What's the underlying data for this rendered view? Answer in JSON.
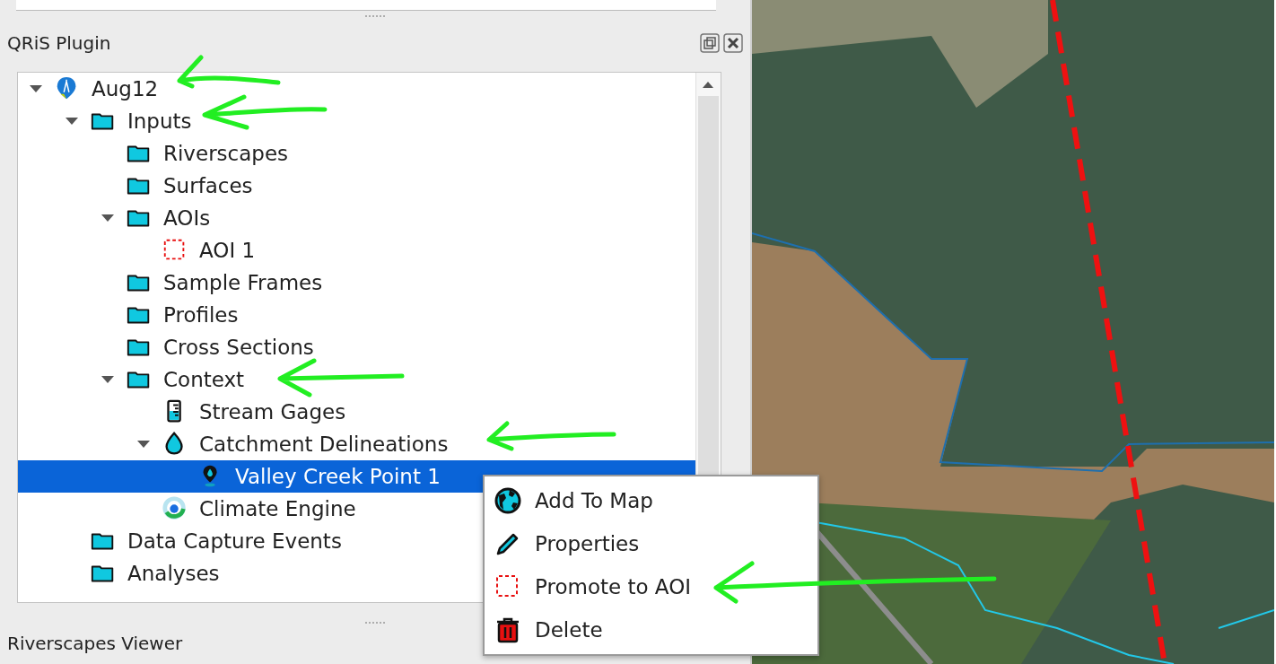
{
  "panel": {
    "title": "QRiS Plugin"
  },
  "tree": [
    {
      "label": "Aug12",
      "kind": "project",
      "expanded": true,
      "selected": false,
      "children": [
        {
          "label": "Inputs",
          "kind": "folder",
          "expanded": true,
          "selected": false,
          "children": [
            {
              "label": "Riverscapes",
              "kind": "folder",
              "selected": false
            },
            {
              "label": "Surfaces",
              "kind": "folder",
              "selected": false
            },
            {
              "label": "AOIs",
              "kind": "folder",
              "expanded": true,
              "selected": false,
              "children": [
                {
                  "label": "AOI 1",
                  "kind": "aoi",
                  "selected": false
                }
              ]
            },
            {
              "label": "Sample Frames",
              "kind": "folder",
              "selected": false
            },
            {
              "label": "Profiles",
              "kind": "folder",
              "selected": false
            },
            {
              "label": "Cross Sections",
              "kind": "folder",
              "selected": false
            },
            {
              "label": "Context",
              "kind": "folder",
              "expanded": true,
              "selected": false,
              "children": [
                {
                  "label": "Stream Gages",
                  "kind": "gage",
                  "selected": false
                },
                {
                  "label": "Catchment Delineations",
                  "kind": "drop",
                  "expanded": true,
                  "selected": false,
                  "children": [
                    {
                      "label": "Valley Creek Point 1",
                      "kind": "pin",
                      "selected": true
                    }
                  ]
                },
                {
                  "label": "Climate Engine",
                  "kind": "climate",
                  "selected": false
                }
              ]
            }
          ]
        },
        {
          "label": "Data Capture Events",
          "kind": "folder",
          "selected": false
        },
        {
          "label": "Analyses",
          "kind": "folder",
          "selected": false
        }
      ]
    }
  ],
  "context_menu": [
    {
      "label": "Add To Map",
      "kind": "globe"
    },
    {
      "label": "Properties",
      "kind": "pencil"
    },
    {
      "label": "Promote to AOI",
      "kind": "aoi"
    },
    {
      "label": "Delete",
      "kind": "trash"
    }
  ],
  "bottom_panel": {
    "title": "Riverscapes Viewer"
  }
}
